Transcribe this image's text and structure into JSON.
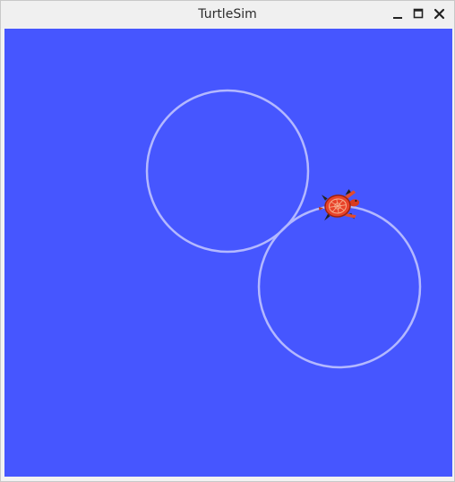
{
  "window": {
    "title": "TurtleSim"
  },
  "controls": {
    "minimize_icon": "minimize-icon",
    "maximize_icon": "maximize-icon",
    "close_icon": "close-icon"
  },
  "canvas": {
    "background_color": "#4656ff",
    "trail_color": "#b3b8ff"
  },
  "turtle": {
    "icon": "turtle-icon",
    "shell_color": "#e8432a",
    "body_color": "#d83a20"
  }
}
